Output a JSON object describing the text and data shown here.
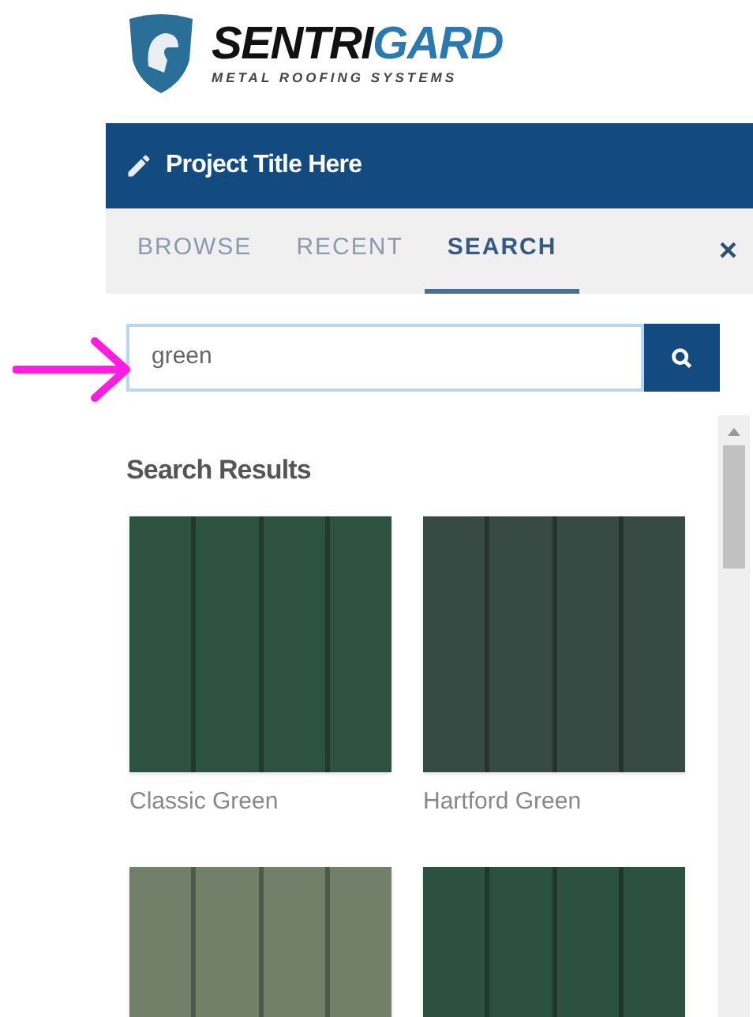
{
  "logo": {
    "name_dark": "SENTRI",
    "name_accent": "GARD",
    "tagline": "METAL ROOFING SYSTEMS"
  },
  "header": {
    "title": "Project Title Here"
  },
  "tabs": [
    {
      "label": "BROWSE",
      "selected": false
    },
    {
      "label": "RECENT",
      "selected": false
    },
    {
      "label": "SEARCH",
      "selected": true
    }
  ],
  "close": "×",
  "search": {
    "value": "green"
  },
  "results": {
    "heading": "Search Results",
    "items": [
      {
        "name": "Classic Green",
        "color": "#2e5240"
      },
      {
        "name": "Hartford Green",
        "color": "#384a44"
      },
      {
        "color": "#728069"
      },
      {
        "color": "#2d5140"
      }
    ]
  }
}
